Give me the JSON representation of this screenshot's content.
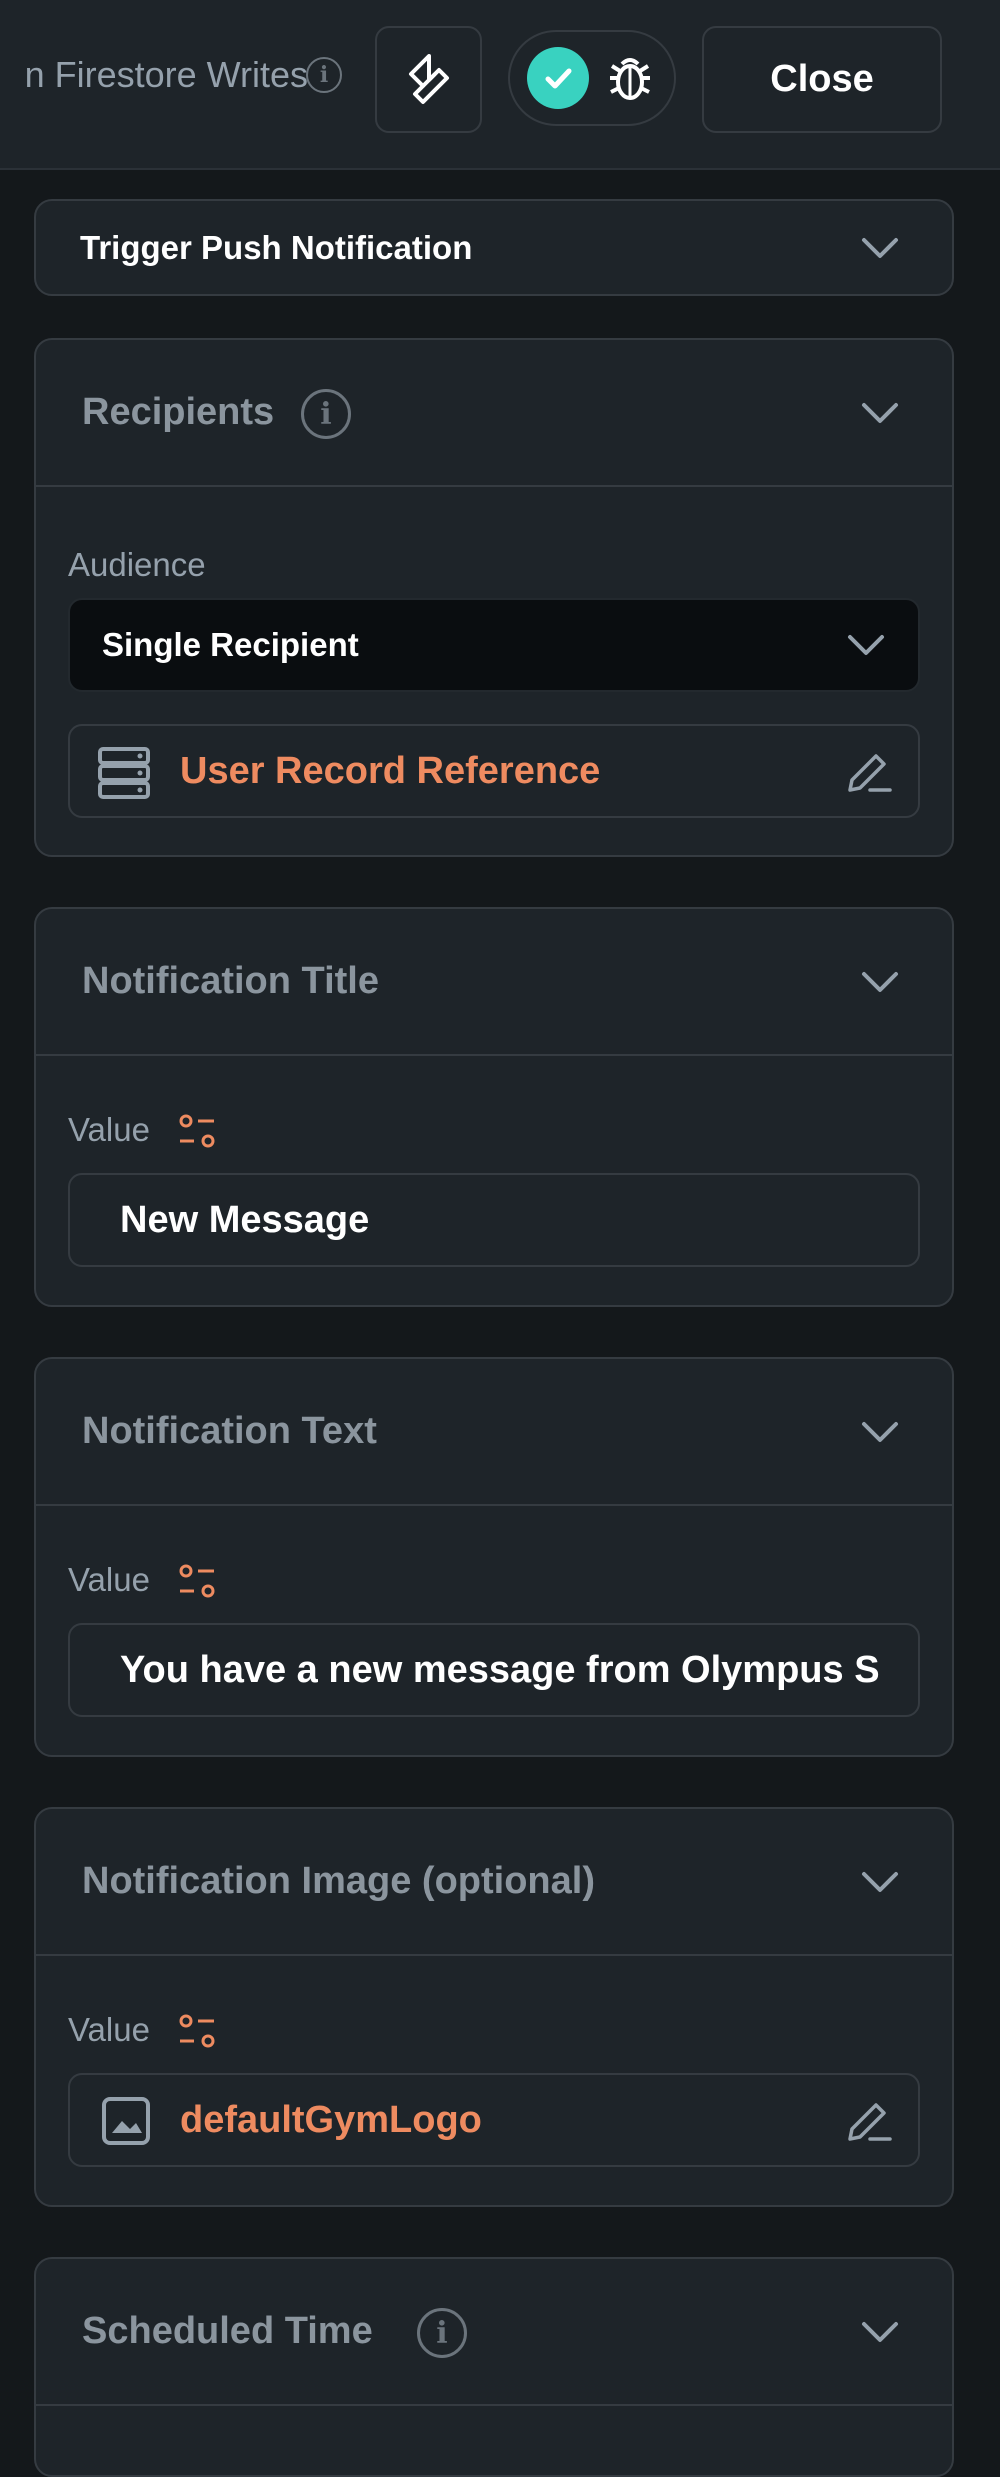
{
  "header": {
    "writes_label": "n Firestore Writes",
    "close_label": "Close"
  },
  "trigger_section": {
    "title": "Trigger Push Notification"
  },
  "recipients_section": {
    "title": "Recipients",
    "audience_label": "Audience",
    "audience_value": "Single Recipient",
    "reference_value": "User Record Reference"
  },
  "title_section": {
    "title": "Notification Title",
    "value_label": "Value",
    "value": "New Message"
  },
  "text_section": {
    "title": "Notification Text",
    "value_label": "Value",
    "value": "You have a new message from Olympus S"
  },
  "image_section": {
    "title": "Notification Image (optional)",
    "value_label": "Value",
    "value": "defaultGymLogo"
  },
  "scheduled_section": {
    "title": "Scheduled Time"
  },
  "colors": {
    "accent": "#ee8b60",
    "success": "#39d2c0",
    "panel": "#1e2429",
    "background": "#14181b"
  }
}
